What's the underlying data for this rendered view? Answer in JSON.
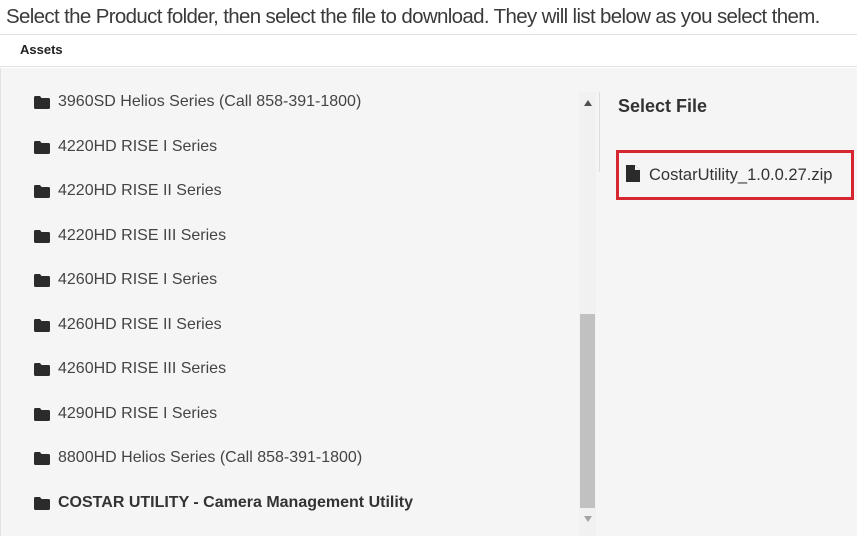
{
  "instruction": "Select the Product folder, then select the file to download. They will list below as you select them.",
  "section": {
    "title": "Assets"
  },
  "folders": [
    {
      "label": "3960SD Helios Series (Call 858-391-1800)",
      "bold": false
    },
    {
      "label": "4220HD RISE I Series",
      "bold": false
    },
    {
      "label": "4220HD RISE II Series",
      "bold": false
    },
    {
      "label": "4220HD RISE III Series",
      "bold": false
    },
    {
      "label": "4260HD RISE I Series",
      "bold": false
    },
    {
      "label": "4260HD RISE II Series",
      "bold": false
    },
    {
      "label": "4260HD RISE III Series",
      "bold": false
    },
    {
      "label": "4290HD RISE I Series",
      "bold": false
    },
    {
      "label": "8800HD Helios Series (Call 858-391-1800)",
      "bold": false
    },
    {
      "label": "COSTAR UTILITY - Camera Management Utility",
      "bold": true
    }
  ],
  "files": {
    "title": "Select File",
    "items": [
      {
        "label": "CostarUtility_1.0.0.27.zip",
        "highlighted": true,
        "highlight_color": "#d6262f"
      }
    ]
  },
  "icons": {
    "folder": "folder-icon",
    "file": "file-icon",
    "scroll_up": "triangle-up-icon",
    "scroll_down": "triangle-down-icon"
  }
}
